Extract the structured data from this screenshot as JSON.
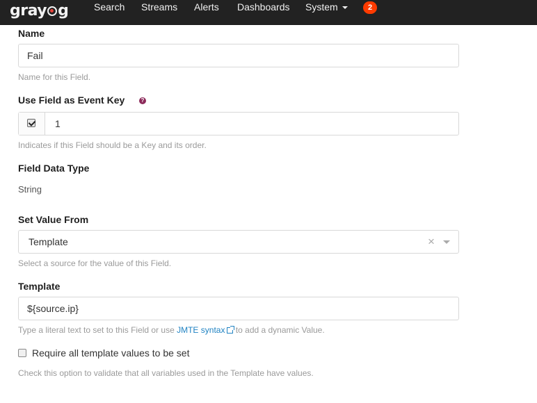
{
  "nav": {
    "logo": {
      "left": "gray",
      "right": "g"
    },
    "items": [
      {
        "label": "Search"
      },
      {
        "label": "Streams"
      },
      {
        "label": "Alerts"
      },
      {
        "label": "Dashboards"
      },
      {
        "label": "System"
      }
    ],
    "notifications_count": "2"
  },
  "form": {
    "name": {
      "label": "Name",
      "value": "Fail",
      "help": "Name for this Field."
    },
    "event_key": {
      "label": "Use Field as Event Key",
      "checked": true,
      "value": "1",
      "help": "Indicates if this Field should be a Key and its order."
    },
    "data_type": {
      "label": "Field Data Type",
      "value": "String"
    },
    "value_from": {
      "label": "Set Value From",
      "selected": "Template",
      "help": "Select a source for the value of this Field."
    },
    "template": {
      "label": "Template",
      "value": "${source.ip}",
      "help_before": "Type a literal text to set to this Field or use ",
      "help_link": "JMTE syntax",
      "help_after": " to add a dynamic Value."
    },
    "require_values": {
      "label": "Require all template values to be set",
      "checked": false,
      "help": "Check this option to validate that all variables used in the Template have values."
    }
  },
  "colors": {
    "navbar": "#222222",
    "badge": "#ff3b00",
    "link": "#1f82c2",
    "help_icon": "#8c2a5a"
  }
}
